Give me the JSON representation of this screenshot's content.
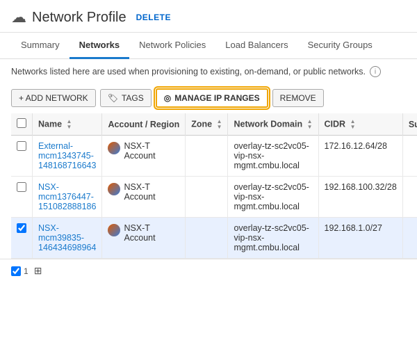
{
  "header": {
    "title": "Network Profile",
    "delete_label": "DELETE",
    "cloud_icon": "☁"
  },
  "tabs": [
    {
      "label": "Summary",
      "active": false
    },
    {
      "label": "Networks",
      "active": true
    },
    {
      "label": "Network Policies",
      "active": false
    },
    {
      "label": "Load Balancers",
      "active": false
    },
    {
      "label": "Security Groups",
      "active": false
    }
  ],
  "info_text": "Networks listed here are used when provisioning to existing, on-demand, or public networks.",
  "toolbar": {
    "add_label": "+ ADD NETWORK",
    "tags_label": "TAGS",
    "manage_label": "MANAGE IP RANGES",
    "remove_label": "REMOVE"
  },
  "table": {
    "columns": [
      {
        "label": "Name",
        "sortable": true
      },
      {
        "label": "Account / Region",
        "sortable": false
      },
      {
        "label": "Zone",
        "sortable": true
      },
      {
        "label": "Network Domain",
        "sortable": true
      },
      {
        "label": "CIDR",
        "sortable": true
      },
      {
        "label": "Su Pu",
        "sortable": false
      }
    ],
    "rows": [
      {
        "checked": false,
        "name": "External-mcm1343745-148168716643",
        "account": "NSX-T Account",
        "zone": "",
        "network_domain": "overlay-tz-sc2vc05-vip-nsx-mgmt.cmbu.local",
        "cidr": "172.16.12.64/28",
        "su_pu": "",
        "selected": false
      },
      {
        "checked": false,
        "name": "NSX-mcm1376447-151082888186",
        "account": "NSX-T Account",
        "zone": "",
        "network_domain": "overlay-tz-sc2vc05-vip-nsx-mgmt.cmbu.local",
        "cidr": "192.168.100.32/28",
        "su_pu": "",
        "selected": false
      },
      {
        "checked": true,
        "name": "NSX-mcm39835-146434698964",
        "account": "NSX-T Account",
        "zone": "",
        "network_domain": "overlay-tz-sc2vc05-vip-nsx-mgmt.cmbu.local",
        "cidr": "192.168.1.0/27",
        "su_pu": "",
        "selected": true
      }
    ]
  },
  "footer": {
    "count": "1",
    "grid_icon": "⊞"
  }
}
